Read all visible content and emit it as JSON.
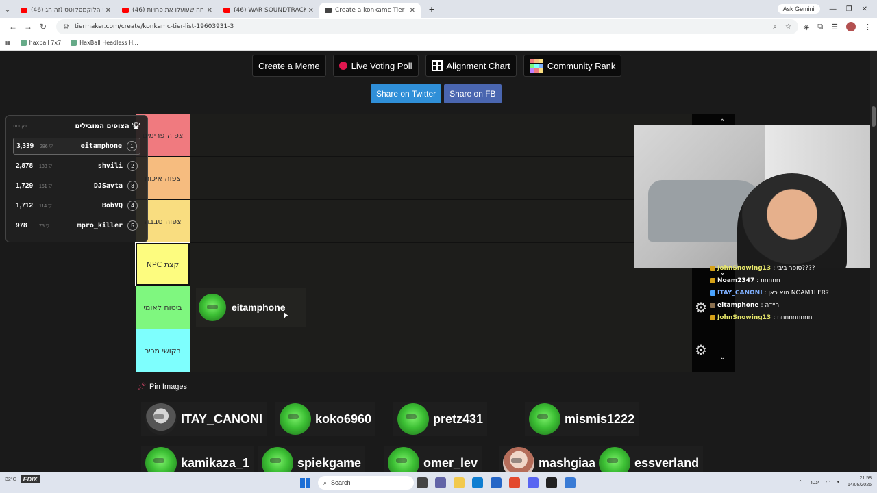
{
  "browser": {
    "tabs": [
      {
        "title": "(46) נורדי הלוקמסקוטט (זה הג",
        "active": false,
        "icon": "youtube-icon"
      },
      {
        "title": "(46) הרווחה שעועלו את פרויות",
        "active": false,
        "icon": "youtube-icon"
      },
      {
        "title": "(46) WAR SOUNDTRACKS| Agg",
        "active": false,
        "icon": "youtube-icon"
      },
      {
        "title": "Create a konkamc Tier List - Tie",
        "active": true,
        "icon": "tiermaker-icon"
      }
    ],
    "new_tab": "+",
    "ask_gemini": "Ask Gemini",
    "url": "tiermaker.com/create/konkamc-tier-list-19603931-3",
    "bookmarks": [
      "haxball 7x7",
      "HaxBall Headless H..."
    ]
  },
  "top_buttons": [
    {
      "label": "Create a Meme"
    },
    {
      "label": "Live Voting Poll"
    },
    {
      "label": "Alignment Chart"
    },
    {
      "label": "Community Rank"
    }
  ],
  "share": {
    "twitter": "Share on Twitter",
    "fb": "Share on FB"
  },
  "tiers": [
    {
      "label": "צפוה פרימים",
      "color": "#f07a7f"
    },
    {
      "label": "צפוה איכות",
      "color": "#f6bc7f"
    },
    {
      "label": "צפוה סבבה",
      "color": "#f9dd80"
    },
    {
      "label": "NPC קצת",
      "color": "#fdfc7f"
    },
    {
      "label": "ביטוח לאומי",
      "color": "#7ff77f"
    },
    {
      "label": "בקושי מכיר",
      "color": "#7efffe"
    }
  ],
  "tier_item": {
    "name": "eitamphone"
  },
  "leaderboard": {
    "title": "הצופים המובילים",
    "points_label": "נקודות",
    "rows": [
      {
        "score": "3,339",
        "chip": "286 ▽",
        "name": "eitamphone",
        "rank": "1"
      },
      {
        "score": "2,878",
        "chip": "188 ▽",
        "name": "shvili",
        "rank": "2"
      },
      {
        "score": "1,729",
        "chip": "151 ▽",
        "name": "DJSavta",
        "rank": "3"
      },
      {
        "score": "1,712",
        "chip": "114 ▽",
        "name": "BobVQ",
        "rank": "4"
      },
      {
        "score": "978",
        "chip": "75 ▽",
        "name": "mpro_killer",
        "rank": "5"
      }
    ]
  },
  "chat": [
    {
      "user": "JohnSnowing13",
      "text": ": סופר ביבי????",
      "color": "#e6e66a"
    },
    {
      "user": "Noam2347",
      "text": ": nnnnn",
      "color": "#ffffff"
    },
    {
      "user": "ITAY_CANONI",
      "text": ": הוא כאן NOAM1LER?",
      "color": "#7fb0ff"
    },
    {
      "user": "eitamphone",
      "text": ": היידה",
      "color": "#ffffff"
    },
    {
      "user": "JohnSnowing13",
      "text": ": nnnnnnnnn",
      "color": "#e6e66a"
    }
  ],
  "pin_images": {
    "title": "Pin Images",
    "items": [
      {
        "name": "ITAY_CANONI",
        "avatar": "bw"
      },
      {
        "name": "koko6960",
        "avatar": "green"
      },
      {
        "name": "pretz431",
        "avatar": "green"
      },
      {
        "name": "mismis1222",
        "avatar": "green"
      },
      {
        "name": "kamikaza_1",
        "avatar": "green"
      },
      {
        "name": "spiekgame",
        "avatar": "green"
      },
      {
        "name": "omer_lev",
        "avatar": "green"
      },
      {
        "name": "mashgiaa",
        "avatar": "photo"
      },
      {
        "name": "essverland",
        "avatar": "green"
      }
    ]
  },
  "taskbar": {
    "search": "Search",
    "weather": "32°C",
    "lang": "עבר",
    "time": "21:58",
    "date": "14/08/2026"
  }
}
